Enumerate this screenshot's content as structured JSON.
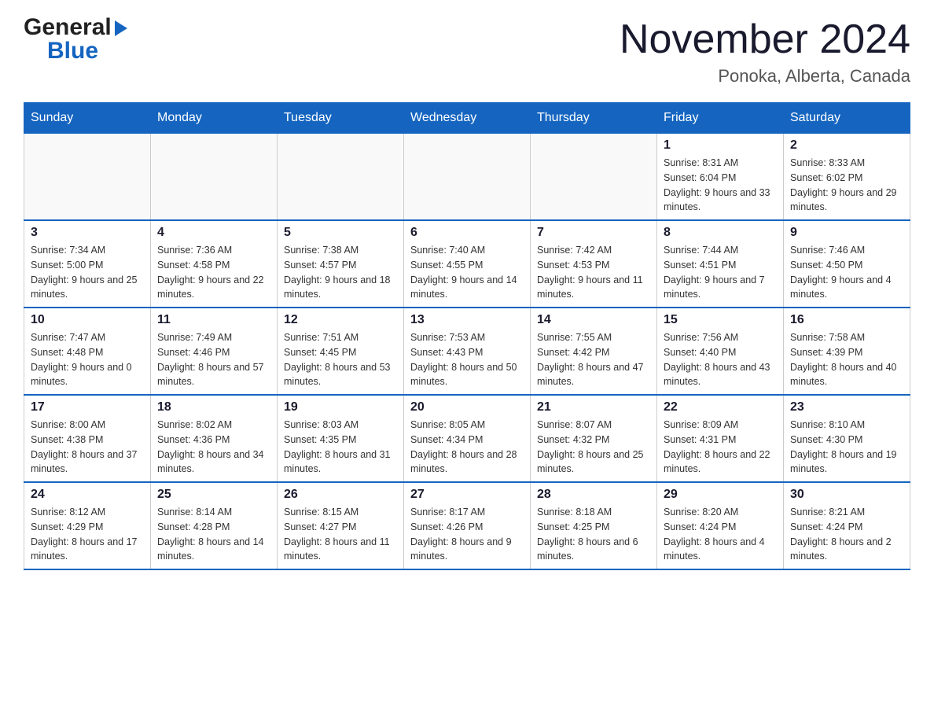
{
  "header": {
    "logo_general": "General",
    "logo_blue": "Blue",
    "month_year": "November 2024",
    "location": "Ponoka, Alberta, Canada"
  },
  "weekdays": [
    "Sunday",
    "Monday",
    "Tuesday",
    "Wednesday",
    "Thursday",
    "Friday",
    "Saturday"
  ],
  "weeks": [
    [
      {
        "day": "",
        "info": ""
      },
      {
        "day": "",
        "info": ""
      },
      {
        "day": "",
        "info": ""
      },
      {
        "day": "",
        "info": ""
      },
      {
        "day": "",
        "info": ""
      },
      {
        "day": "1",
        "info": "Sunrise: 8:31 AM\nSunset: 6:04 PM\nDaylight: 9 hours and 33 minutes."
      },
      {
        "day": "2",
        "info": "Sunrise: 8:33 AM\nSunset: 6:02 PM\nDaylight: 9 hours and 29 minutes."
      }
    ],
    [
      {
        "day": "3",
        "info": "Sunrise: 7:34 AM\nSunset: 5:00 PM\nDaylight: 9 hours and 25 minutes."
      },
      {
        "day": "4",
        "info": "Sunrise: 7:36 AM\nSunset: 4:58 PM\nDaylight: 9 hours and 22 minutes."
      },
      {
        "day": "5",
        "info": "Sunrise: 7:38 AM\nSunset: 4:57 PM\nDaylight: 9 hours and 18 minutes."
      },
      {
        "day": "6",
        "info": "Sunrise: 7:40 AM\nSunset: 4:55 PM\nDaylight: 9 hours and 14 minutes."
      },
      {
        "day": "7",
        "info": "Sunrise: 7:42 AM\nSunset: 4:53 PM\nDaylight: 9 hours and 11 minutes."
      },
      {
        "day": "8",
        "info": "Sunrise: 7:44 AM\nSunset: 4:51 PM\nDaylight: 9 hours and 7 minutes."
      },
      {
        "day": "9",
        "info": "Sunrise: 7:46 AM\nSunset: 4:50 PM\nDaylight: 9 hours and 4 minutes."
      }
    ],
    [
      {
        "day": "10",
        "info": "Sunrise: 7:47 AM\nSunset: 4:48 PM\nDaylight: 9 hours and 0 minutes."
      },
      {
        "day": "11",
        "info": "Sunrise: 7:49 AM\nSunset: 4:46 PM\nDaylight: 8 hours and 57 minutes."
      },
      {
        "day": "12",
        "info": "Sunrise: 7:51 AM\nSunset: 4:45 PM\nDaylight: 8 hours and 53 minutes."
      },
      {
        "day": "13",
        "info": "Sunrise: 7:53 AM\nSunset: 4:43 PM\nDaylight: 8 hours and 50 minutes."
      },
      {
        "day": "14",
        "info": "Sunrise: 7:55 AM\nSunset: 4:42 PM\nDaylight: 8 hours and 47 minutes."
      },
      {
        "day": "15",
        "info": "Sunrise: 7:56 AM\nSunset: 4:40 PM\nDaylight: 8 hours and 43 minutes."
      },
      {
        "day": "16",
        "info": "Sunrise: 7:58 AM\nSunset: 4:39 PM\nDaylight: 8 hours and 40 minutes."
      }
    ],
    [
      {
        "day": "17",
        "info": "Sunrise: 8:00 AM\nSunset: 4:38 PM\nDaylight: 8 hours and 37 minutes."
      },
      {
        "day": "18",
        "info": "Sunrise: 8:02 AM\nSunset: 4:36 PM\nDaylight: 8 hours and 34 minutes."
      },
      {
        "day": "19",
        "info": "Sunrise: 8:03 AM\nSunset: 4:35 PM\nDaylight: 8 hours and 31 minutes."
      },
      {
        "day": "20",
        "info": "Sunrise: 8:05 AM\nSunset: 4:34 PM\nDaylight: 8 hours and 28 minutes."
      },
      {
        "day": "21",
        "info": "Sunrise: 8:07 AM\nSunset: 4:32 PM\nDaylight: 8 hours and 25 minutes."
      },
      {
        "day": "22",
        "info": "Sunrise: 8:09 AM\nSunset: 4:31 PM\nDaylight: 8 hours and 22 minutes."
      },
      {
        "day": "23",
        "info": "Sunrise: 8:10 AM\nSunset: 4:30 PM\nDaylight: 8 hours and 19 minutes."
      }
    ],
    [
      {
        "day": "24",
        "info": "Sunrise: 8:12 AM\nSunset: 4:29 PM\nDaylight: 8 hours and 17 minutes."
      },
      {
        "day": "25",
        "info": "Sunrise: 8:14 AM\nSunset: 4:28 PM\nDaylight: 8 hours and 14 minutes."
      },
      {
        "day": "26",
        "info": "Sunrise: 8:15 AM\nSunset: 4:27 PM\nDaylight: 8 hours and 11 minutes."
      },
      {
        "day": "27",
        "info": "Sunrise: 8:17 AM\nSunset: 4:26 PM\nDaylight: 8 hours and 9 minutes."
      },
      {
        "day": "28",
        "info": "Sunrise: 8:18 AM\nSunset: 4:25 PM\nDaylight: 8 hours and 6 minutes."
      },
      {
        "day": "29",
        "info": "Sunrise: 8:20 AM\nSunset: 4:24 PM\nDaylight: 8 hours and 4 minutes."
      },
      {
        "day": "30",
        "info": "Sunrise: 8:21 AM\nSunset: 4:24 PM\nDaylight: 8 hours and 2 minutes."
      }
    ]
  ]
}
